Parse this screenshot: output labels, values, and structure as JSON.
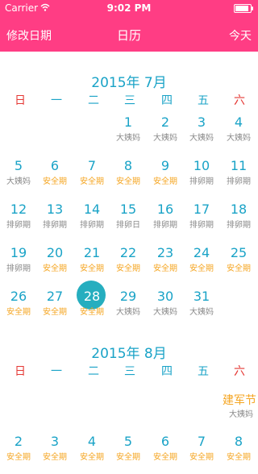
{
  "status_bar": {
    "carrier": "Carrier",
    "time": "9:02 PM",
    "battery_level": 0.9
  },
  "navbar": {
    "left": "修改日期",
    "title": "日历",
    "right": "今天"
  },
  "weekdays": [
    "日",
    "一",
    "二",
    "三",
    "四",
    "五",
    "六"
  ],
  "months": [
    {
      "title": "2015年 7月",
      "days": [
        {
          "d": "1",
          "l": "大姨妈",
          "c": "grey"
        },
        {
          "d": "2",
          "l": "大姨妈",
          "c": "grey"
        },
        {
          "d": "3",
          "l": "大姨妈",
          "c": "grey"
        },
        {
          "d": "4",
          "l": "大姨妈",
          "c": "grey"
        },
        {
          "d": "5",
          "l": "大姨妈",
          "c": "grey"
        },
        {
          "d": "6",
          "l": "安全期",
          "c": "orange"
        },
        {
          "d": "7",
          "l": "安全期",
          "c": "orange"
        },
        {
          "d": "8",
          "l": "安全期",
          "c": "orange"
        },
        {
          "d": "9",
          "l": "安全期",
          "c": "orange"
        },
        {
          "d": "10",
          "l": "排卵期",
          "c": "grey"
        },
        {
          "d": "11",
          "l": "排卵期",
          "c": "grey"
        },
        {
          "d": "12",
          "l": "排卵期",
          "c": "grey"
        },
        {
          "d": "13",
          "l": "排卵期",
          "c": "grey"
        },
        {
          "d": "14",
          "l": "排卵期",
          "c": "grey"
        },
        {
          "d": "15",
          "l": "排卵日",
          "c": "grey"
        },
        {
          "d": "16",
          "l": "排卵期",
          "c": "grey"
        },
        {
          "d": "17",
          "l": "排卵期",
          "c": "grey"
        },
        {
          "d": "18",
          "l": "排卵期",
          "c": "grey"
        },
        {
          "d": "19",
          "l": "排卵期",
          "c": "grey"
        },
        {
          "d": "20",
          "l": "安全期",
          "c": "orange"
        },
        {
          "d": "21",
          "l": "安全期",
          "c": "orange"
        },
        {
          "d": "22",
          "l": "安全期",
          "c": "orange"
        },
        {
          "d": "23",
          "l": "安全期",
          "c": "orange"
        },
        {
          "d": "24",
          "l": "安全期",
          "c": "orange"
        },
        {
          "d": "25",
          "l": "安全期",
          "c": "orange"
        },
        {
          "d": "26",
          "l": "安全期",
          "c": "orange"
        },
        {
          "d": "27",
          "l": "安全期",
          "c": "orange"
        },
        {
          "d": "28",
          "l": "安全期",
          "c": "orange",
          "today": true
        },
        {
          "d": "29",
          "l": "大姨妈",
          "c": "grey"
        },
        {
          "d": "30",
          "l": "大姨妈",
          "c": "grey"
        },
        {
          "d": "31",
          "l": "大姨妈",
          "c": "grey"
        }
      ]
    },
    {
      "title": "2015年 8月",
      "holiday": {
        "name": "建军节",
        "label": "大姨妈"
      },
      "days": [
        {
          "d": "2",
          "l": "安全期",
          "c": "orange"
        },
        {
          "d": "3",
          "l": "安全期",
          "c": "orange"
        },
        {
          "d": "4",
          "l": "安全期",
          "c": "orange"
        },
        {
          "d": "5",
          "l": "安全期",
          "c": "orange"
        },
        {
          "d": "6",
          "l": "安全期",
          "c": "orange"
        },
        {
          "d": "7",
          "l": "安全期",
          "c": "orange"
        },
        {
          "d": "8",
          "l": "安全期",
          "c": "orange"
        }
      ]
    }
  ]
}
